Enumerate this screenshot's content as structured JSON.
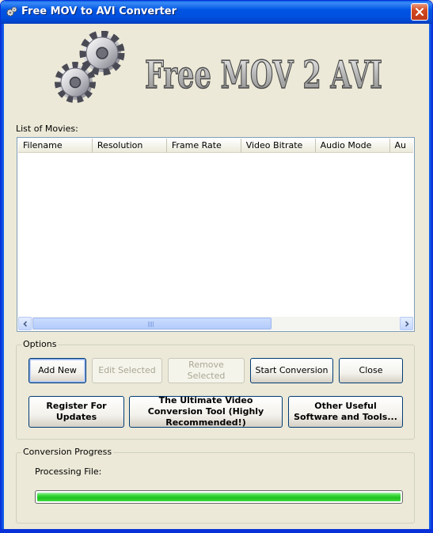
{
  "window": {
    "title": "Free MOV to AVI Converter"
  },
  "logo": {
    "text": "Free MOV 2 AVI"
  },
  "list": {
    "label": "List of Movies:",
    "columns": [
      "Filename",
      "Resolution",
      "Frame Rate",
      "Video Bitrate",
      "Audio Mode",
      "Au"
    ]
  },
  "options": {
    "title": "Options",
    "add_new": "Add New",
    "edit_selected": "Edit Selected",
    "remove_selected": "Remove Selected",
    "start_conversion": "Start Conversion",
    "close": "Close",
    "register": "Register For Updates",
    "ultimate_tool": "The Ultimate Video Conversion Tool (Highly Recommended!)",
    "other_software": "Other Useful Software and Tools..."
  },
  "progress": {
    "title": "Conversion Progress",
    "processing_label": "Processing File:",
    "percent": 100
  },
  "colors": {
    "progress_fill": "#20C020",
    "titlebar": "#0054E3",
    "window_bg": "#ECE9D8"
  },
  "icons": [
    "app-gear-icon",
    "close-icon",
    "gears-logo-icon",
    "scroll-left-icon",
    "scroll-right-icon"
  ]
}
